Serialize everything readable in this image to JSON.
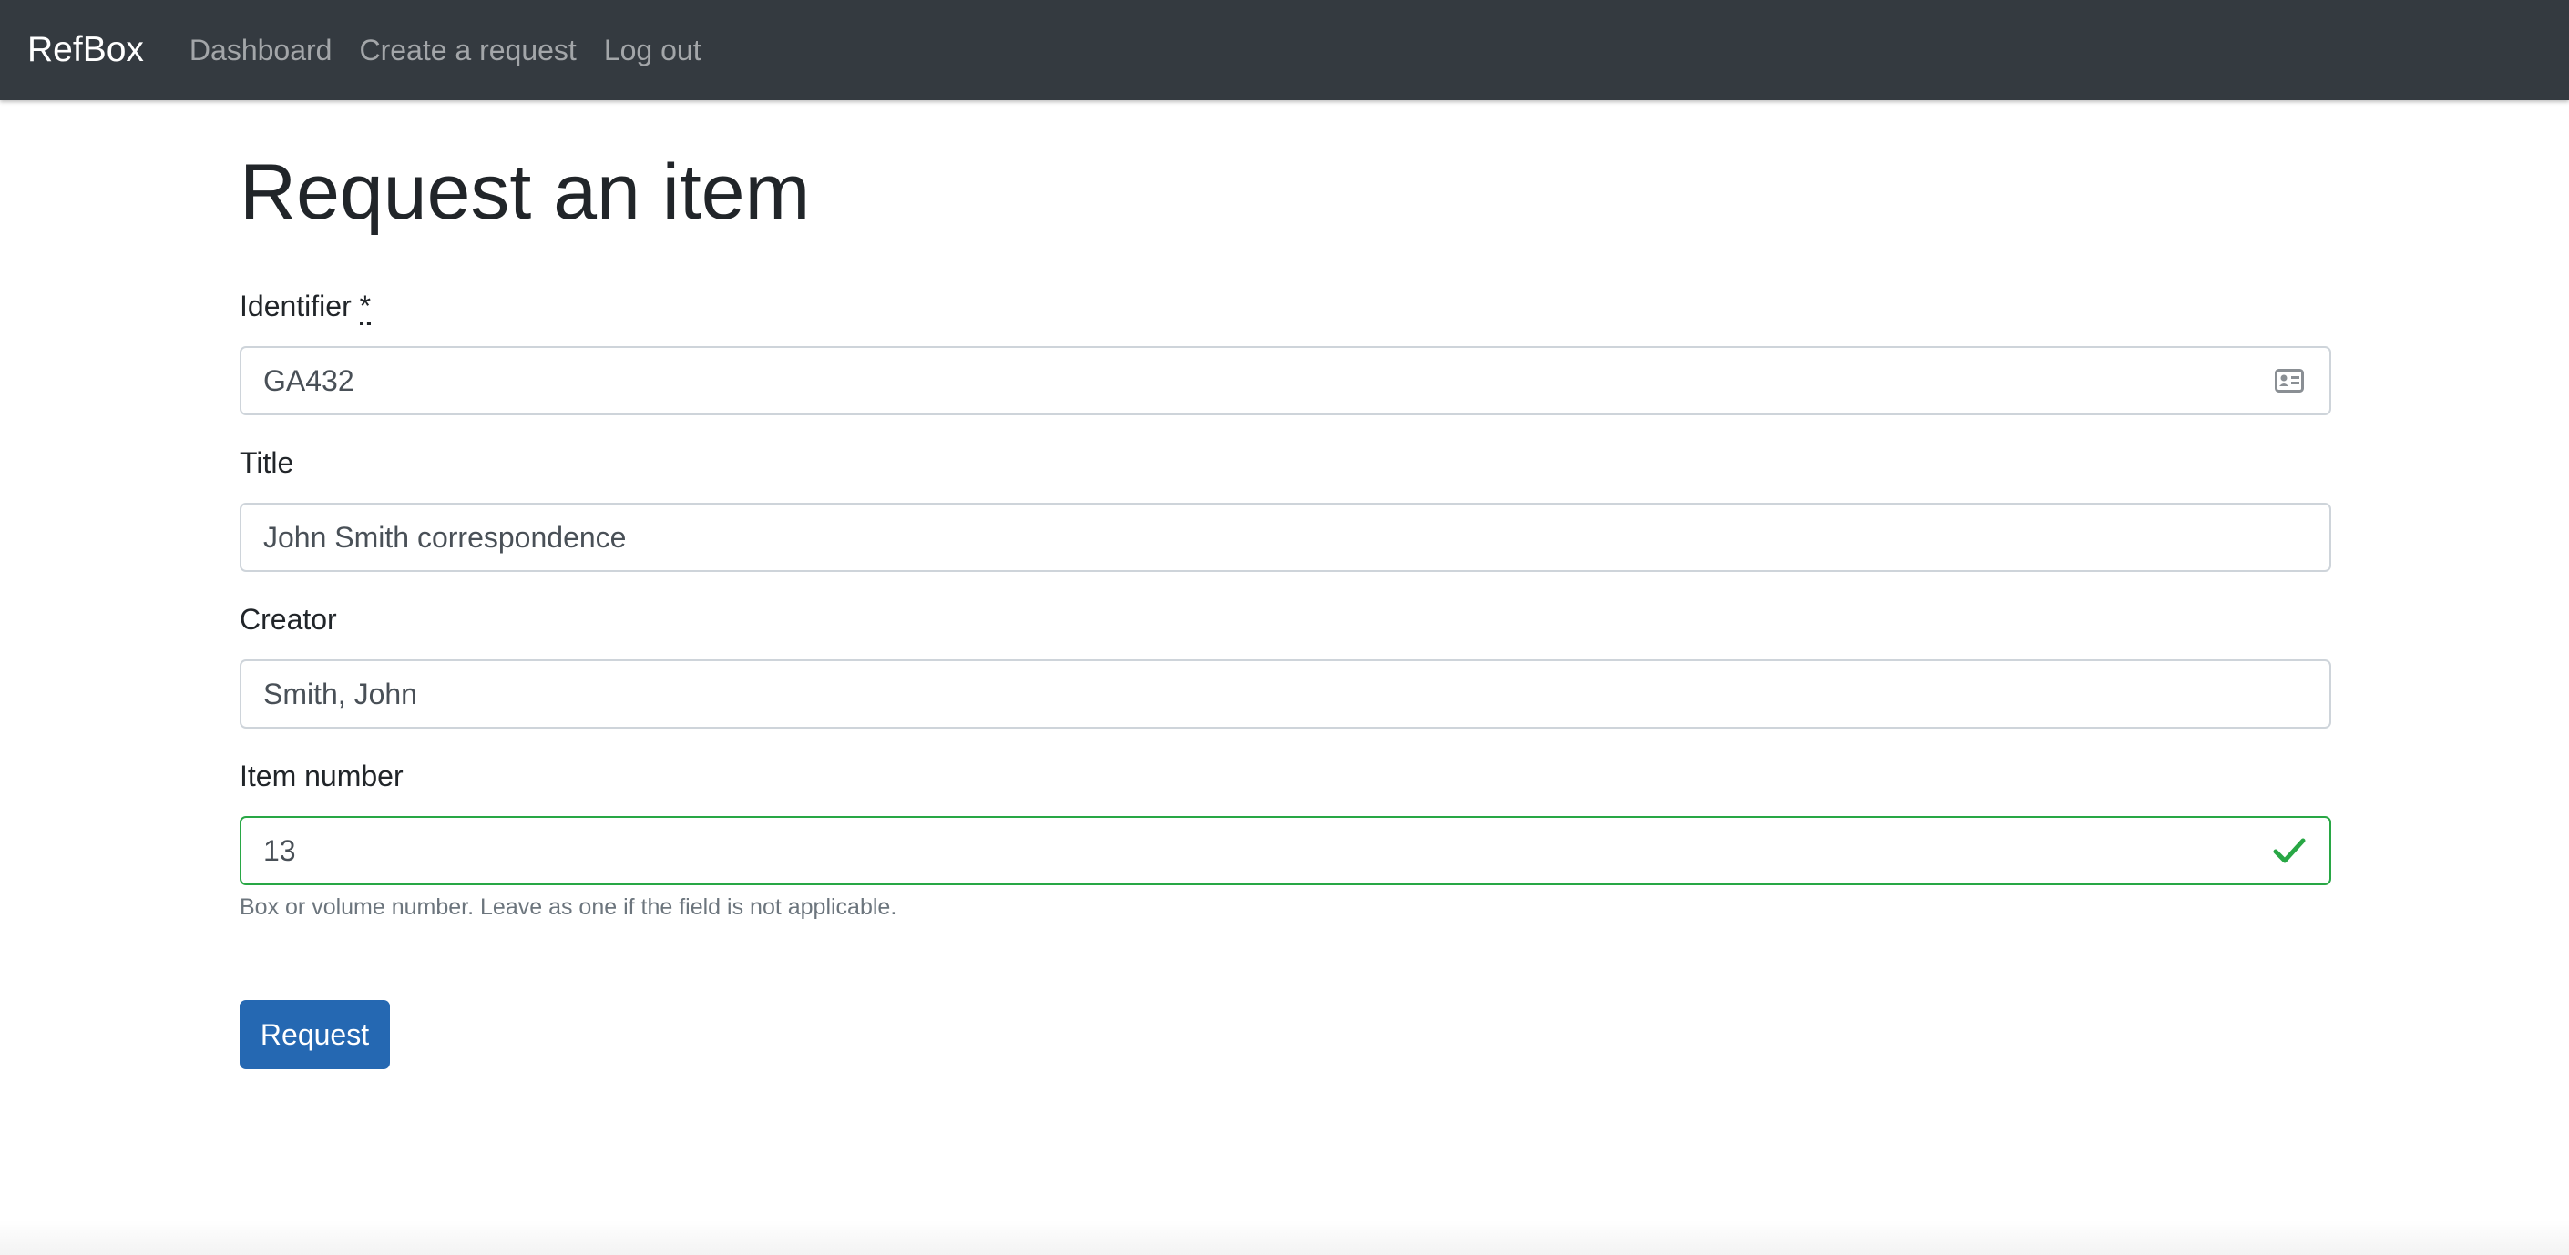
{
  "navbar": {
    "brand": "RefBox",
    "links": [
      {
        "label": "Dashboard"
      },
      {
        "label": "Create a request"
      },
      {
        "label": "Log out"
      }
    ]
  },
  "page": {
    "title": "Request an item"
  },
  "form": {
    "identifier": {
      "label": "Identifier",
      "required_mark": "*",
      "value": "GA432",
      "icon": "id-card-icon"
    },
    "title": {
      "label": "Title",
      "value": "John Smith correspondence"
    },
    "creator": {
      "label": "Creator",
      "value": "Smith, John"
    },
    "item_number": {
      "label": "Item number",
      "value": "13",
      "icon": "checkmark-icon",
      "help": "Box or volume number. Leave as one if the field is not applicable."
    },
    "submit_label": "Request"
  },
  "colors": {
    "navbar_bg": "#343a40",
    "primary": "#2568b2",
    "valid": "#28a745"
  }
}
